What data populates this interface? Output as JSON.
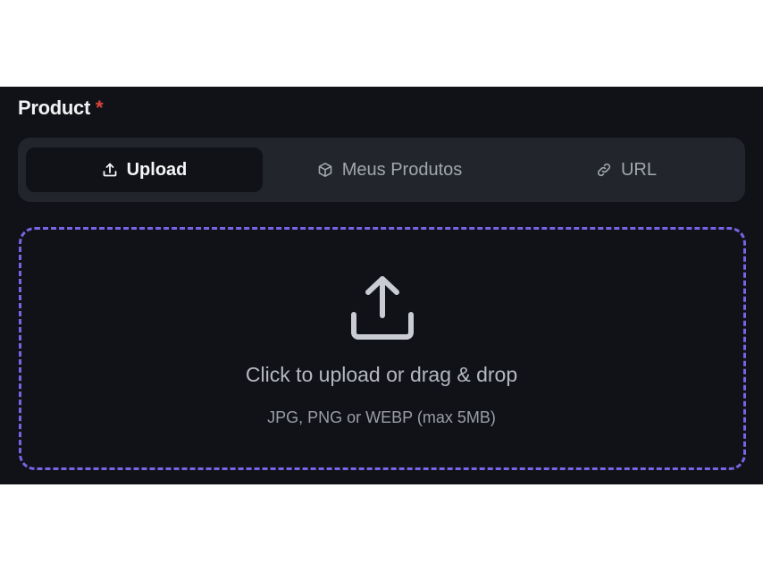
{
  "field": {
    "label": "Product",
    "required_mark": "*"
  },
  "tabs": [
    {
      "label": "Upload",
      "icon": "upload-icon",
      "active": true
    },
    {
      "label": "Meus Produtos",
      "icon": "package-icon",
      "active": false
    },
    {
      "label": "URL",
      "icon": "link-icon",
      "active": false
    }
  ],
  "dropzone": {
    "icon": "upload-icon",
    "title": "Click to upload or drag & drop",
    "hint": "JPG, PNG or WEBP (max 5MB)"
  },
  "colors": {
    "panel_background": "#111217",
    "tabs_background": "#22252c",
    "accent_dashed_border": "#7a63e6",
    "required": "#e0443c"
  }
}
